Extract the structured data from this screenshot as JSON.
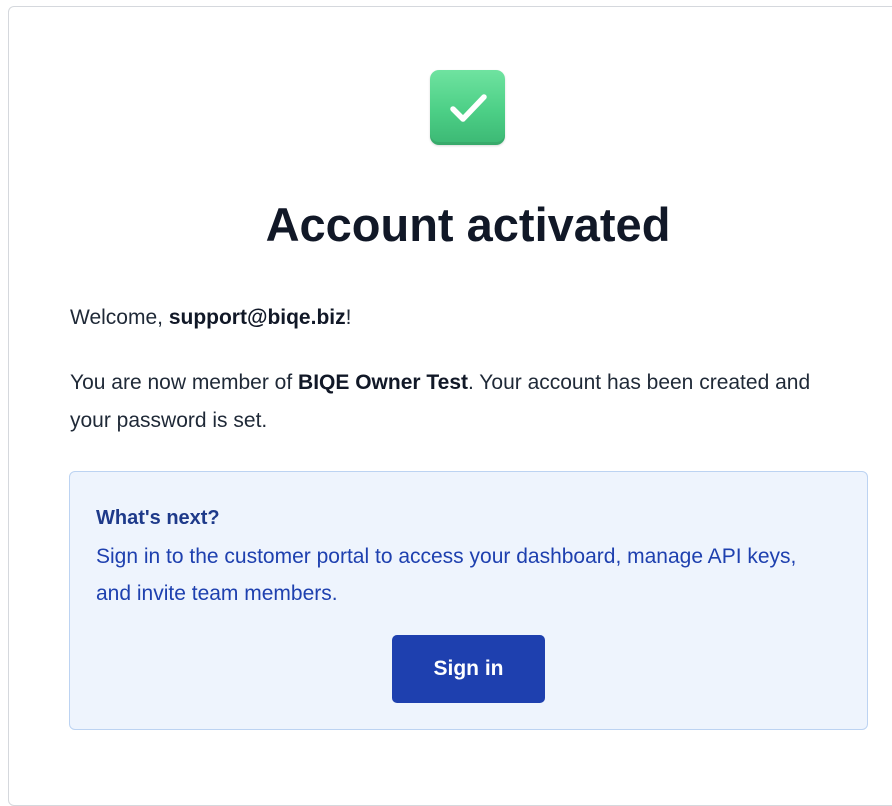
{
  "status_icon": "check-mark-icon",
  "colors": {
    "badge": "#4ccf86",
    "title": "#111827",
    "info_bg": "#eef4fd",
    "info_border": "#bcd3f2",
    "info_text": "#1e40af",
    "button": "#1e40af"
  },
  "title": "Account activated",
  "welcome": {
    "prefix": "Welcome, ",
    "email": "support@biqe.biz",
    "suffix": "!"
  },
  "membership": {
    "prefix": "You are now member of ",
    "org": "BIQE Owner Test",
    "suffix": ". Your account has been created and your password is set."
  },
  "next": {
    "heading": "What's next?",
    "body": "Sign in to the customer portal to access your dashboard, manage API keys, and invite team members.",
    "button_label": "Sign in"
  }
}
